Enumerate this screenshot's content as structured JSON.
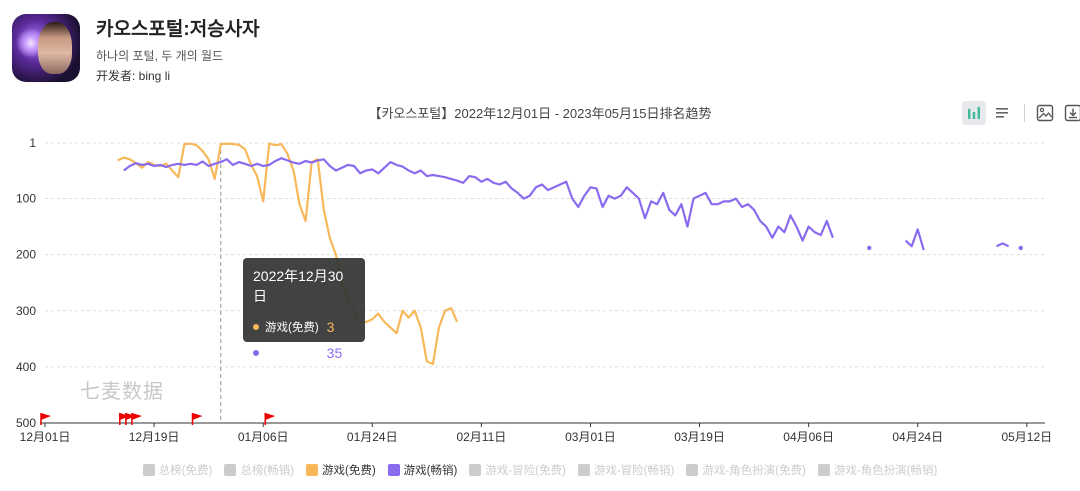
{
  "app": {
    "title": "카오스포털:저승사자",
    "subtitle": "하나의 포털, 두 개의 월드",
    "developer": "开发者: bing li"
  },
  "chart_title": "【카오스포털】2022年12月01日 - 2023年05月15日排名趋势",
  "toolbar": {
    "icons": [
      "bar-chart-icon",
      "list-icon",
      "image-save-icon",
      "download-icon"
    ]
  },
  "watermark": "七麦数据",
  "tooltip": {
    "date": "2022年12月30日",
    "rows": [
      {
        "name": "游戏(免费)",
        "value": "3"
      },
      {
        "name": "游戏(畅销)",
        "value": "35"
      }
    ]
  },
  "chart_data": {
    "type": "line",
    "title": "【카오스포털】2022年12月01日 - 2023年05月15日排名趋势",
    "y_inverted": true,
    "ylim": [
      1,
      500
    ],
    "y_ticks": [
      1,
      100,
      200,
      300,
      400,
      500
    ],
    "x_range_days": [
      0,
      165
    ],
    "x_tick_labels": [
      "12月01日",
      "12月19日",
      "01月06日",
      "01月24日",
      "02月11日",
      "03月01日",
      "03月19日",
      "04月06日",
      "04月24日",
      "05月12日"
    ],
    "x_tick_days": [
      0,
      18,
      36,
      54,
      72,
      90,
      108,
      126,
      144,
      162
    ],
    "hover_day": 29,
    "series": [
      {
        "name": "游戏(免费)",
        "color": "#f7b85a",
        "points": [
          [
            12,
            32
          ],
          [
            13,
            27
          ],
          [
            14,
            30
          ],
          [
            15,
            37
          ],
          [
            16,
            45
          ],
          [
            17,
            35
          ],
          [
            18,
            40
          ],
          [
            19,
            42
          ],
          [
            20,
            38
          ],
          [
            21,
            50
          ],
          [
            22,
            62
          ],
          [
            23,
            3
          ],
          [
            24,
            2
          ],
          [
            25,
            5
          ],
          [
            26,
            15
          ],
          [
            27,
            30
          ],
          [
            28,
            65
          ],
          [
            29,
            3
          ],
          [
            30,
            2
          ],
          [
            31,
            3
          ],
          [
            32,
            4
          ],
          [
            33,
            12
          ],
          [
            34,
            40
          ],
          [
            35,
            60
          ],
          [
            36,
            105
          ],
          [
            37,
            2
          ],
          [
            38,
            5
          ],
          [
            39,
            3
          ],
          [
            40,
            20
          ],
          [
            41,
            50
          ],
          [
            42,
            110
          ],
          [
            43,
            140
          ],
          [
            44,
            35
          ],
          [
            45,
            30
          ],
          [
            46,
            120
          ],
          [
            47,
            170
          ],
          [
            48,
            200
          ],
          [
            49,
            250
          ],
          [
            50,
            280
          ],
          [
            51,
            300
          ],
          [
            52,
            320
          ],
          [
            53,
            320
          ],
          [
            54,
            315
          ],
          [
            55,
            305
          ],
          [
            56,
            320
          ],
          [
            57,
            330
          ],
          [
            58,
            340
          ],
          [
            59,
            300
          ],
          [
            60,
            312
          ],
          [
            61,
            300
          ],
          [
            62,
            330
          ],
          [
            63,
            390
          ],
          [
            64,
            395
          ],
          [
            65,
            330
          ],
          [
            66,
            300
          ],
          [
            67,
            295
          ],
          [
            68,
            320
          ]
        ]
      },
      {
        "name": "游戏(畅销)",
        "color": "#8a6bef",
        "points": [
          [
            13,
            50
          ],
          [
            14,
            42
          ],
          [
            15,
            37
          ],
          [
            16,
            40
          ],
          [
            17,
            38
          ],
          [
            18,
            42
          ],
          [
            19,
            40
          ],
          [
            20,
            44
          ],
          [
            21,
            40
          ],
          [
            22,
            38
          ],
          [
            23,
            40
          ],
          [
            24,
            38
          ],
          [
            25,
            40
          ],
          [
            26,
            34
          ],
          [
            27,
            42
          ],
          [
            28,
            38
          ],
          [
            29,
            35
          ],
          [
            30,
            30
          ],
          [
            31,
            40
          ],
          [
            32,
            35
          ],
          [
            33,
            38
          ],
          [
            34,
            42
          ],
          [
            35,
            38
          ],
          [
            36,
            42
          ],
          [
            37,
            40
          ],
          [
            38,
            33
          ],
          [
            39,
            28
          ],
          [
            40,
            32
          ],
          [
            41,
            36
          ],
          [
            42,
            38
          ],
          [
            43,
            33
          ],
          [
            44,
            36
          ],
          [
            45,
            32
          ],
          [
            46,
            30
          ],
          [
            47,
            42
          ],
          [
            48,
            50
          ],
          [
            49,
            45
          ],
          [
            50,
            40
          ],
          [
            51,
            42
          ],
          [
            52,
            55
          ],
          [
            53,
            50
          ],
          [
            54,
            48
          ],
          [
            55,
            55
          ],
          [
            56,
            45
          ],
          [
            57,
            35
          ],
          [
            58,
            40
          ],
          [
            59,
            43
          ],
          [
            60,
            50
          ],
          [
            61,
            55
          ],
          [
            62,
            50
          ],
          [
            63,
            60
          ],
          [
            64,
            58
          ],
          [
            65,
            60
          ],
          [
            66,
            62
          ],
          [
            67,
            65
          ],
          [
            68,
            68
          ],
          [
            69,
            72
          ],
          [
            70,
            60
          ],
          [
            71,
            62
          ],
          [
            72,
            70
          ],
          [
            73,
            65
          ],
          [
            74,
            72
          ],
          [
            75,
            75
          ],
          [
            76,
            70
          ],
          [
            77,
            82
          ],
          [
            78,
            90
          ],
          [
            79,
            100
          ],
          [
            80,
            95
          ],
          [
            81,
            80
          ],
          [
            82,
            75
          ],
          [
            83,
            85
          ],
          [
            84,
            80
          ],
          [
            85,
            75
          ],
          [
            86,
            70
          ],
          [
            87,
            100
          ],
          [
            88,
            115
          ],
          [
            89,
            95
          ],
          [
            90,
            80
          ],
          [
            91,
            82
          ],
          [
            92,
            115
          ],
          [
            93,
            95
          ],
          [
            94,
            100
          ],
          [
            95,
            95
          ],
          [
            96,
            80
          ],
          [
            97,
            90
          ],
          [
            98,
            100
          ],
          [
            99,
            135
          ],
          [
            100,
            105
          ],
          [
            101,
            110
          ],
          [
            102,
            90
          ],
          [
            103,
            120
          ],
          [
            104,
            130
          ],
          [
            105,
            110
          ],
          [
            106,
            150
          ],
          [
            107,
            100
          ],
          [
            108,
            95
          ],
          [
            109,
            90
          ],
          [
            110,
            110
          ],
          [
            111,
            110
          ],
          [
            112,
            105
          ],
          [
            113,
            105
          ],
          [
            114,
            100
          ],
          [
            115,
            115
          ],
          [
            116,
            110
          ],
          [
            117,
            120
          ],
          [
            118,
            140
          ],
          [
            119,
            150
          ],
          [
            120,
            170
          ],
          [
            121,
            150
          ],
          [
            122,
            160
          ],
          [
            123,
            130
          ],
          [
            124,
            150
          ],
          [
            125,
            175
          ],
          [
            126,
            150
          ],
          [
            127,
            160
          ],
          [
            128,
            165
          ],
          [
            129,
            140
          ],
          [
            130,
            170
          ]
        ],
        "isolated_points": [
          [
            136,
            188
          ]
        ],
        "extra_segments": [
          [
            [
              142,
              175
            ],
            [
              143,
              185
            ],
            [
              144,
              155
            ],
            [
              145,
              192
            ]
          ],
          [
            [
              157,
              185
            ],
            [
              158,
              180
            ],
            [
              159,
              185
            ]
          ],
          [
            [
              161,
              188
            ]
          ]
        ]
      }
    ],
    "marker_days": [
      0,
      13,
      14,
      15,
      25,
      37
    ],
    "legend": [
      {
        "name": "总榜(免费)",
        "active": false,
        "color": "#cccccc"
      },
      {
        "name": "总榜(畅销)",
        "active": false,
        "color": "#cccccc"
      },
      {
        "name": "游戏(免费)",
        "active": true,
        "color": "#f7b85a"
      },
      {
        "name": "游戏(畅销)",
        "active": true,
        "color": "#8a6bef"
      },
      {
        "name": "游戏-冒险(免费)",
        "active": false,
        "color": "#cccccc"
      },
      {
        "name": "游戏-冒险(畅销)",
        "active": false,
        "color": "#cccccc"
      },
      {
        "name": "游戏-角色扮演(免费)",
        "active": false,
        "color": "#cccccc"
      },
      {
        "name": "游戏-角色扮演(畅销)",
        "active": false,
        "color": "#cccccc"
      }
    ]
  }
}
